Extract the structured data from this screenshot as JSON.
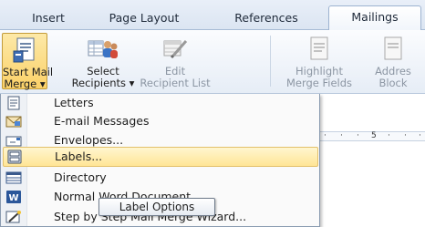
{
  "ribbon_tabs": [
    {
      "label": "Insert"
    },
    {
      "label": "Page Layout"
    },
    {
      "label": "References"
    },
    {
      "label": "Mailings"
    }
  ],
  "ribbon_buttons": {
    "start_mail_merge": {
      "line1": "Start Mail",
      "line2": "Merge ▾"
    },
    "select_recipients": {
      "line1": "Select",
      "line2": "Recipients ▾"
    },
    "edit_recipient_list": {
      "line1": "Edit",
      "line2": "Recipient List"
    },
    "highlight_merge_fields": {
      "line1": "Highlight",
      "line2": "Merge Fields"
    },
    "address_block": {
      "line1": "Addres",
      "line2": "Block"
    }
  },
  "ruler": {
    "mark": "5"
  },
  "start_mail_merge_menu": [
    {
      "label": "Letters",
      "icon": "letter-icon"
    },
    {
      "label": "E-mail Messages",
      "icon": "envelope-icon"
    },
    {
      "label": "Envelopes...",
      "icon": "envelope-front-icon"
    },
    {
      "label": "Labels...",
      "icon": "labels-icon"
    },
    {
      "label": "Directory",
      "icon": "directory-icon"
    },
    {
      "label": "Normal Word Document",
      "icon": "word-icon"
    },
    {
      "label": "Step by Step Mail Merge Wizard...",
      "icon": "wizard-icon"
    }
  ],
  "tooltip": {
    "text": "Label Options"
  },
  "colors": {
    "highlight": "#ffe596",
    "accent_blue": "#2b579a",
    "ribbon_bg": "#e6edf6"
  }
}
